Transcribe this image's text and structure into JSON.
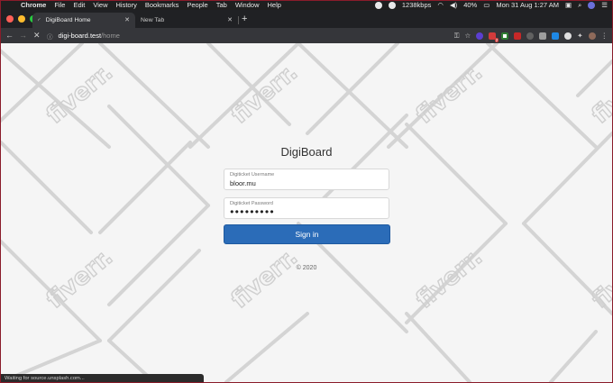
{
  "menubar": {
    "app": "Chrome",
    "items": [
      "File",
      "Edit",
      "View",
      "History",
      "Bookmarks",
      "People",
      "Tab",
      "Window",
      "Help"
    ],
    "network_speed": "1238kbps",
    "battery": "40%",
    "datetime": "Mon 31 Aug  1:27 AM"
  },
  "tabs": [
    {
      "title": "DigiBoard Home",
      "active": true
    },
    {
      "title": "New Tab",
      "active": false
    }
  ],
  "toolbar": {
    "url_host": "digi-board.test",
    "url_path": "/home",
    "extension_badge": "2"
  },
  "login": {
    "brand": "DigiBoard",
    "username_label": "Digiticket Username",
    "username_value": "bloor.mu",
    "password_label": "Digiticket Password",
    "password_value": "●●●●●●●●●",
    "signin_label": "Sign in",
    "copyright": "© 2020"
  },
  "watermark": {
    "text": "fiverr."
  },
  "status": {
    "text": "Waiting for source.unsplash.com..."
  },
  "colors": {
    "primary_button": "#2b6cb8",
    "page_background": "#f5f5f5",
    "tab_active": "#35363a",
    "tabstrip": "#202124"
  }
}
